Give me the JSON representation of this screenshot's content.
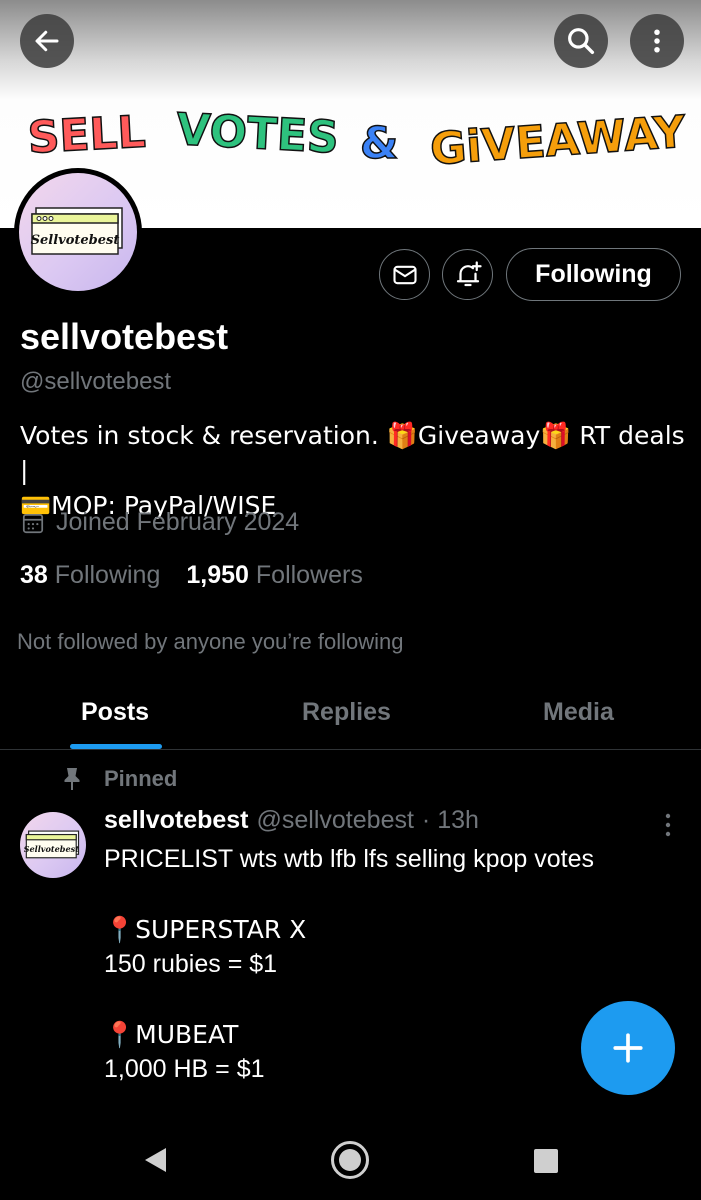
{
  "banner": {
    "words": [
      "SELL",
      "VOTES",
      "&",
      "GiVEAWAY"
    ]
  },
  "profile": {
    "display_name": "sellvotebest",
    "handle": "@sellvotebest",
    "avatar_text": "Sellvotebest",
    "bio_line1": "Votes in stock & reservation. 🎁Giveaway🎁 RT deals |",
    "bio_line2": "💳MOP: PayPal/WISE",
    "joined": "Joined February 2024",
    "following_count": "38",
    "following_label": "Following",
    "followers_count": "1,950",
    "followers_label": "Followers",
    "not_followed": "Not followed by anyone you’re following",
    "follow_button": "Following"
  },
  "tabs": [
    {
      "label": "Posts",
      "active": true
    },
    {
      "label": "Replies",
      "active": false
    },
    {
      "label": "Media",
      "active": false
    }
  ],
  "post": {
    "pinned_label": "Pinned",
    "author_name": "sellvotebest",
    "author_handle": "@sellvotebest",
    "time": "· 13h",
    "line1": "PRICELIST wts wtb lfb lfs selling kpop votes",
    "line2": "📍SUPERSTAR X",
    "line3": "150 rubies = $1",
    "line4": "📍MUBEAT",
    "line5": "1,000 HB = $1"
  },
  "colors": {
    "accent": "#1d9bf0",
    "text_secondary": "#71767b",
    "border": "#2f3336"
  },
  "icons": {
    "back": "arrow-left-icon",
    "search": "search-icon",
    "more": "vertical-dots-icon",
    "message": "envelope-icon",
    "notify": "bell-plus-icon",
    "calendar": "calendar-icon",
    "pin": "pin-icon",
    "compose": "plus-icon"
  }
}
